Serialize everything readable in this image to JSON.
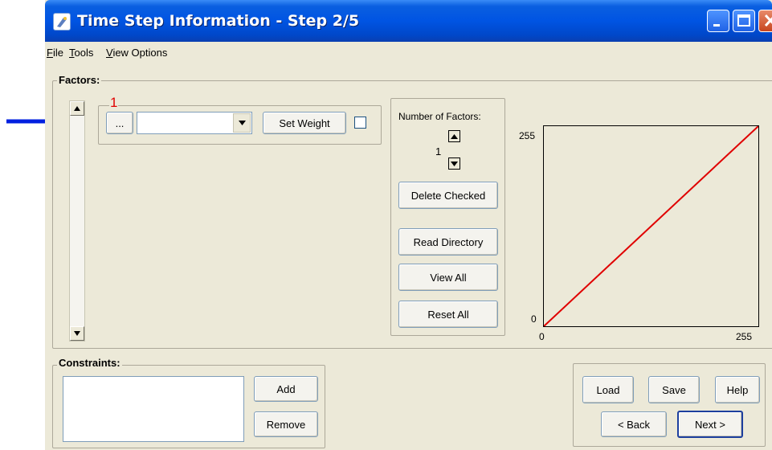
{
  "window": {
    "title": "Time Step Information - Step 2/5",
    "controls": {
      "minimize": "minimize",
      "maximize": "maximize",
      "close": "close"
    }
  },
  "menu": {
    "items": [
      "File",
      "Tools",
      "View Options"
    ]
  },
  "factors": {
    "label": "Factors:",
    "row": {
      "index": "1",
      "browse_label": "...",
      "combo_value": "",
      "set_weight_label": "Set Weight",
      "checked": false
    },
    "number_of_factors_label": "Number of Factors:",
    "number_of_factors_value": "1",
    "delete_checked_label": "Delete Checked",
    "read_directory_label": "Read Directory",
    "view_all_label": "View All",
    "reset_all_label": "Reset All"
  },
  "chart_data": {
    "type": "line",
    "x": [
      0,
      255
    ],
    "y": [
      0,
      255
    ],
    "xlim": [
      0,
      255
    ],
    "ylim": [
      0,
      255
    ],
    "x_tick_labels": [
      "0",
      "255"
    ],
    "y_tick_labels": [
      "0",
      "255"
    ],
    "line_color": "#e00000",
    "title": "",
    "xlabel": "",
    "ylabel": ""
  },
  "constraints": {
    "label": "Constraints:",
    "add_label": "Add",
    "remove_label": "Remove"
  },
  "footer": {
    "load_label": "Load",
    "save_label": "Save",
    "help_label": "Help",
    "back_label": "< Back",
    "next_label": "Next >"
  },
  "annotation": {
    "color": "#0020e0",
    "number_color": "#e00000"
  }
}
